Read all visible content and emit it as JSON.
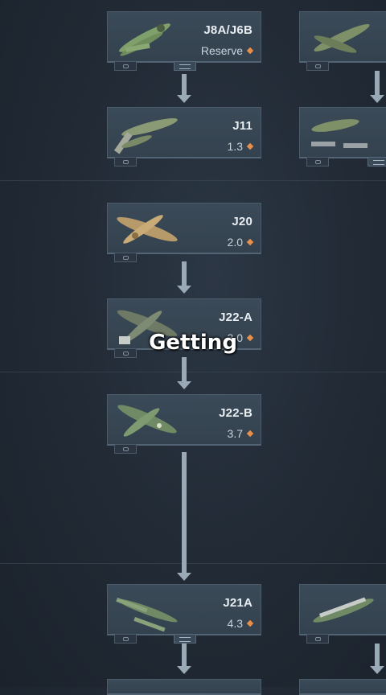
{
  "tree": {
    "vehicles": [
      {
        "name": "J8A/J6B",
        "br": "Reserve",
        "plane_color": "#7fa06a"
      },
      {
        "name": "J11",
        "br": "1.3",
        "plane_color": "#8a9a74"
      },
      {
        "name": "J20",
        "br": "2.0",
        "plane_color": "#b79a6a"
      },
      {
        "name": "J22-A",
        "br": "3.0",
        "plane_color": "#6e7a66"
      },
      {
        "name": "J22-B",
        "br": "3.7",
        "plane_color": "#6f8a64"
      },
      {
        "name": "J21A",
        "br": "4.3",
        "plane_color": "#6f8a64"
      }
    ]
  },
  "caption": {
    "text": "Getting"
  }
}
